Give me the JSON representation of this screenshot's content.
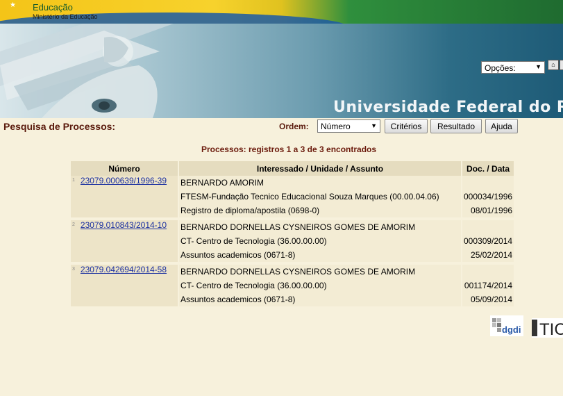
{
  "gov": {
    "title": "Educação",
    "subtitle": "Ministério da Educação"
  },
  "banner": {
    "university": "Universidade Federal do R"
  },
  "top_controls": {
    "opcoes_label": "Opções:",
    "home_icon": "home-icon"
  },
  "search": {
    "title": "Pesquisa de Processos:",
    "order_label": "Ordem:",
    "order_value": "Número",
    "buttons": {
      "criterios": "Critérios",
      "resultado": "Resultado",
      "ajuda": "Ajuda"
    }
  },
  "results": {
    "summary": "Processos: registros 1 a 3 de 3 encontrados",
    "headers": {
      "numero": "Número",
      "interessado": "Interessado / Unidade / Assunto",
      "doc": "Doc. / Data"
    },
    "rows": [
      {
        "index": "1",
        "numero": "23079.000639/1996-39",
        "interessado": "BERNARDO AMORIM",
        "unidade": "FTESM-Fundação Tecnico Educacional Souza Marques (00.00.04.06)",
        "assunto": "Registro de diploma/apostila (0698-0)",
        "doc": "000034/1996",
        "data": "08/01/1996"
      },
      {
        "index": "2",
        "numero": "23079.010843/2014-10",
        "interessado": "BERNARDO DORNELLAS CYSNEIROS GOMES DE AMORIM",
        "unidade": "CT- Centro de Tecnologia (36.00.00.00)",
        "assunto": "Assuntos academicos (0671-8)",
        "doc": "000309/2014",
        "data": "25/02/2014"
      },
      {
        "index": "3",
        "numero": "23079.042694/2014-58",
        "interessado": "BERNARDO DORNELLAS CYSNEIROS GOMES DE AMORIM",
        "unidade": "CT- Centro de Tecnologia (36.00.00.00)",
        "assunto": "Assuntos academicos (0671-8)",
        "doc": "001174/2014",
        "data": "05/09/2014"
      }
    ]
  },
  "logos": {
    "dgdi": "dgdi",
    "tic": "TIC"
  },
  "colors": {
    "background": "#f7f1dc",
    "title": "#5a1a0c",
    "link": "#1a2fa0",
    "header_cell": "#e5dcbf"
  }
}
